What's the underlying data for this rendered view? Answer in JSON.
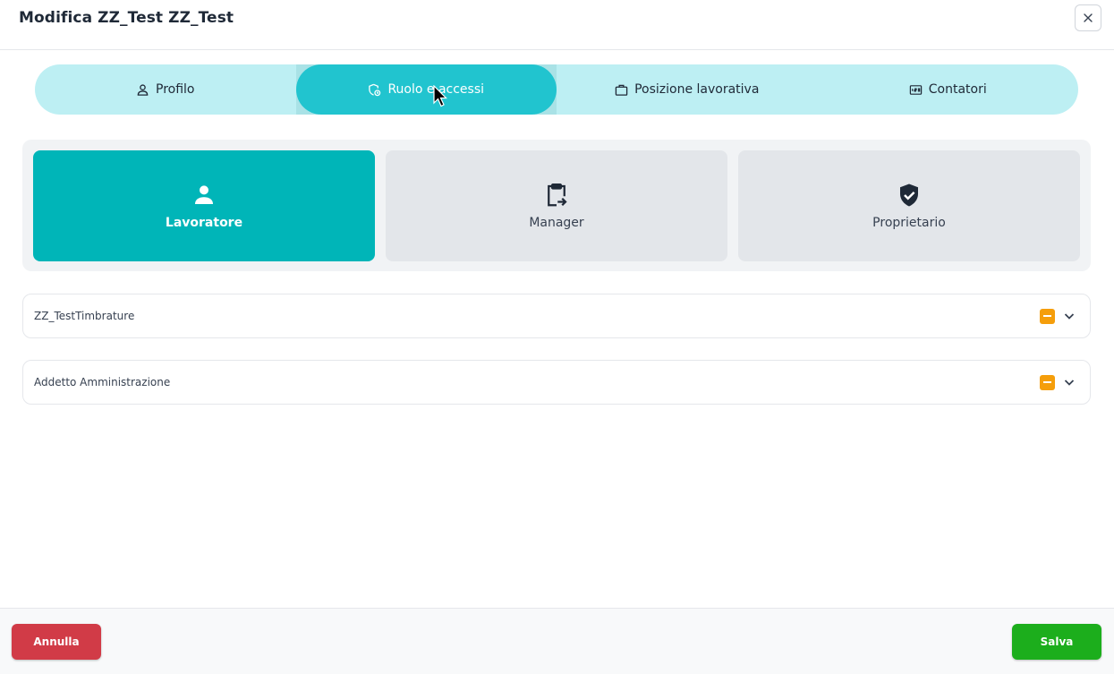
{
  "header": {
    "title": "Modifica ZZ_Test ZZ_Test",
    "close_icon": "close-icon"
  },
  "tabs": [
    {
      "label": "Profilo",
      "icon": "user-icon",
      "active": false
    },
    {
      "label": "Ruolo e accessi",
      "icon": "shield-lock-icon",
      "active": true
    },
    {
      "label": "Posizione lavorativa",
      "icon": "briefcase-icon",
      "active": false
    },
    {
      "label": "Contatori",
      "icon": "counter-icon",
      "active": false
    }
  ],
  "roles": [
    {
      "label": "Lavoratore",
      "icon": "person-icon",
      "selected": true
    },
    {
      "label": "Manager",
      "icon": "clipboard-arrow-icon",
      "selected": false
    },
    {
      "label": "Proprietario",
      "icon": "shield-check-icon",
      "selected": false
    }
  ],
  "groups": [
    {
      "label": "ZZ_TestTimbrature",
      "badge_color": "#f59e0b"
    },
    {
      "label": "Addetto Amministrazione",
      "badge_color": "#f59e0b"
    }
  ],
  "footer": {
    "cancel_label": "Annulla",
    "save_label": "Salva"
  },
  "colors": {
    "accent": "#21c4cf",
    "selected_role": "#00b5b8",
    "cancel": "#d13b47",
    "save": "#1cae1c",
    "badge": "#f59e0b"
  }
}
